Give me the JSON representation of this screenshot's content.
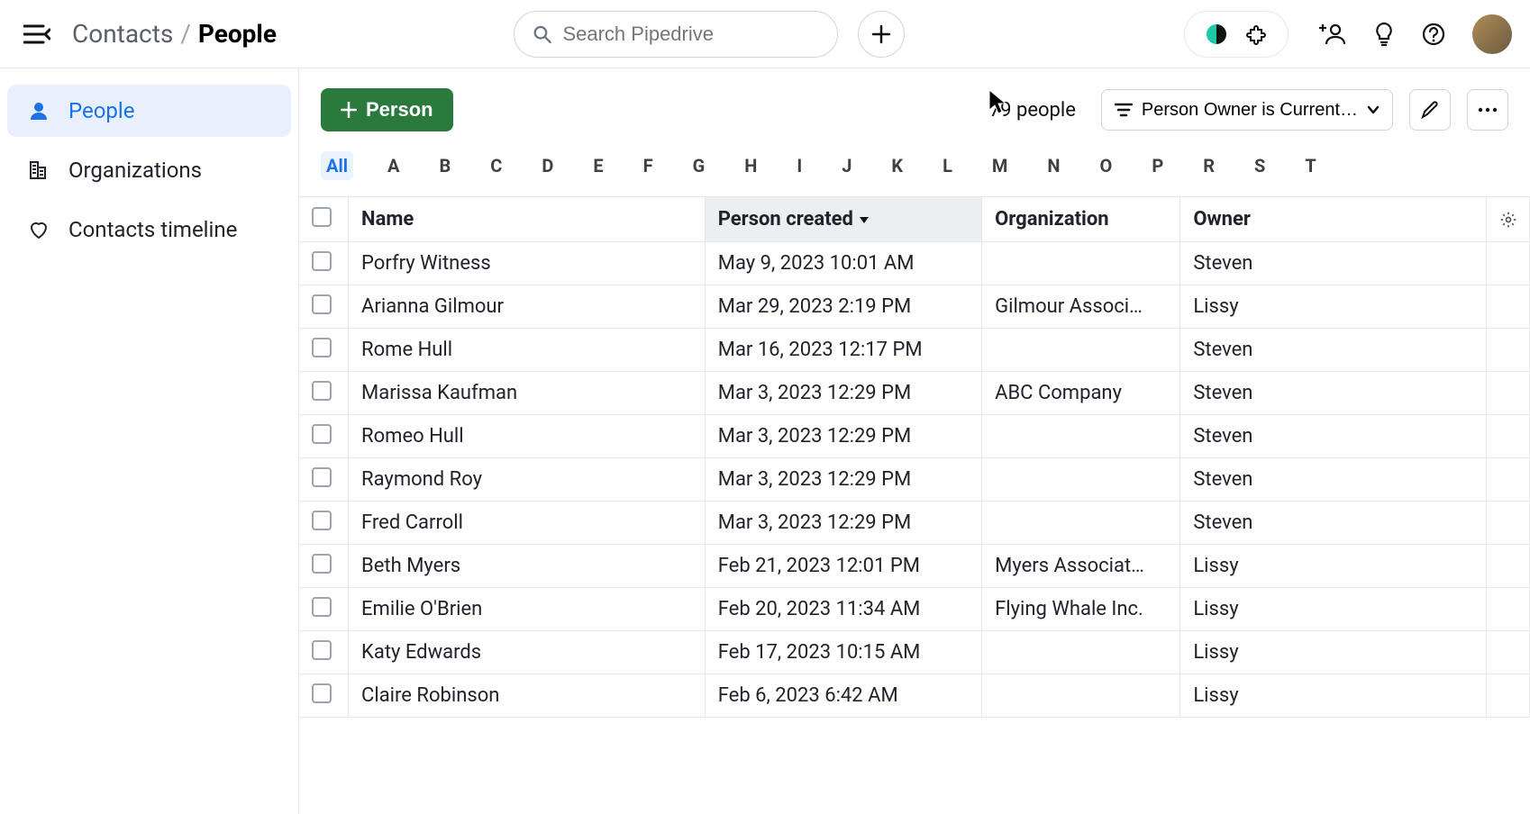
{
  "header": {
    "breadcrumb_section": "Contacts",
    "breadcrumb_current": "People",
    "search_placeholder": "Search Pipedrive"
  },
  "sidebar": {
    "items": [
      {
        "label": "People",
        "icon": "person-icon",
        "active": true
      },
      {
        "label": "Organizations",
        "icon": "building-icon",
        "active": false
      },
      {
        "label": "Contacts timeline",
        "icon": "heart-icon",
        "active": false
      }
    ]
  },
  "toolbar": {
    "add_label": "Person",
    "count_text": "79 people",
    "filter_label": "Person Owner is Current…"
  },
  "alpha": {
    "items": [
      "All",
      "A",
      "B",
      "C",
      "D",
      "E",
      "F",
      "G",
      "H",
      "I",
      "J",
      "K",
      "L",
      "M",
      "N",
      "O",
      "P",
      "R",
      "S",
      "T"
    ],
    "active": "All"
  },
  "table": {
    "columns": [
      {
        "key": "name",
        "label": "Name"
      },
      {
        "key": "created",
        "label": "Person created",
        "sorted": "desc"
      },
      {
        "key": "organization",
        "label": "Organization"
      },
      {
        "key": "owner",
        "label": "Owner"
      }
    ],
    "rows": [
      {
        "name": "Porfry Witness",
        "created": "May 9, 2023 10:01 AM",
        "organization": "",
        "owner": "Steven"
      },
      {
        "name": "Arianna Gilmour",
        "created": "Mar 29, 2023 2:19 PM",
        "organization": "Gilmour Associ…",
        "owner": "Lissy"
      },
      {
        "name": "Rome Hull",
        "created": "Mar 16, 2023 12:17 PM",
        "organization": "",
        "owner": "Steven"
      },
      {
        "name": "Marissa Kaufman",
        "created": "Mar 3, 2023 12:29 PM",
        "organization": "ABC Company",
        "owner": "Steven"
      },
      {
        "name": "Romeo Hull",
        "created": "Mar 3, 2023 12:29 PM",
        "organization": "",
        "owner": "Steven"
      },
      {
        "name": "Raymond Roy",
        "created": "Mar 3, 2023 12:29 PM",
        "organization": "",
        "owner": "Steven"
      },
      {
        "name": "Fred Carroll",
        "created": "Mar 3, 2023 12:29 PM",
        "organization": "",
        "owner": "Steven"
      },
      {
        "name": "Beth Myers",
        "created": "Feb 21, 2023 12:01 PM",
        "organization": "Myers Associat…",
        "owner": "Lissy"
      },
      {
        "name": "Emilie O'Brien",
        "created": "Feb 20, 2023 11:34 AM",
        "organization": "Flying Whale Inc.",
        "owner": "Lissy"
      },
      {
        "name": "Katy Edwards",
        "created": "Feb 17, 2023 10:15 AM",
        "organization": "",
        "owner": "Lissy"
      },
      {
        "name": "Claire Robinson",
        "created": "Feb 6, 2023 6:42 AM",
        "organization": "",
        "owner": "Lissy"
      }
    ]
  }
}
